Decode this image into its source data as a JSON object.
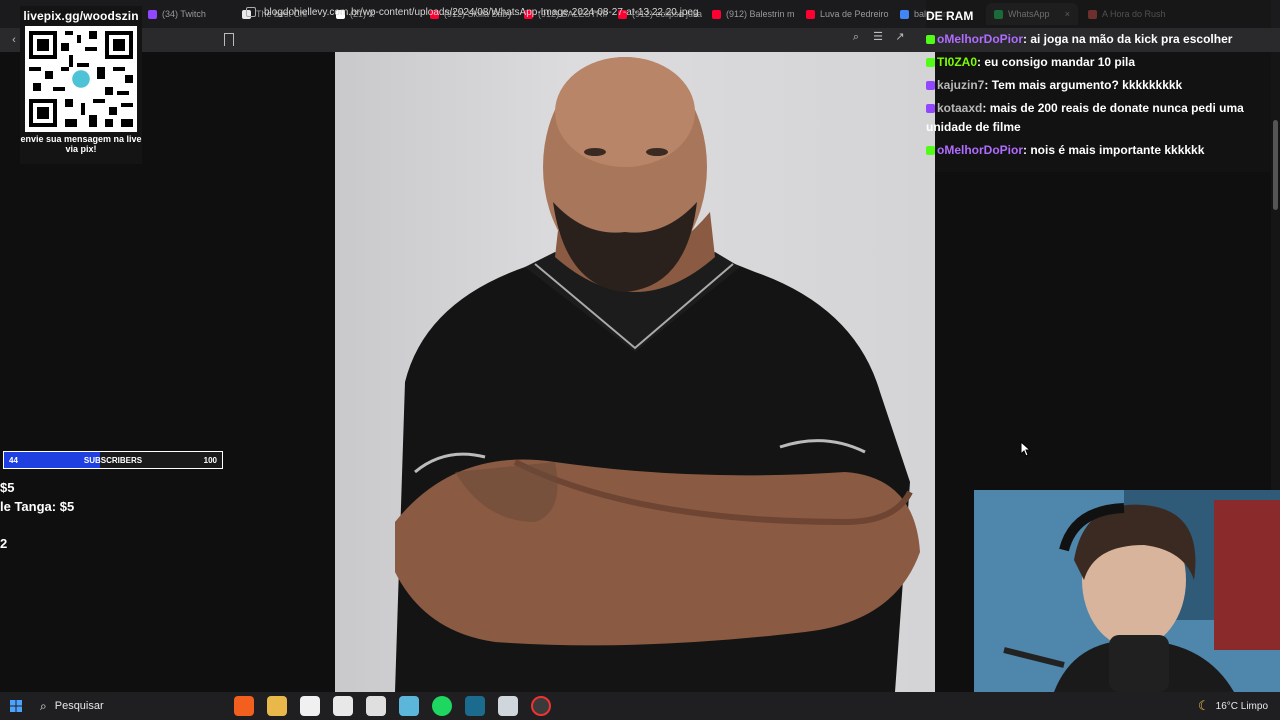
{
  "browser": {
    "tabs": [
      {
        "label": "(34) Twitch",
        "color": "#9146ff"
      },
      {
        "label": "The best Chi",
        "color": "#e8e8e8"
      },
      {
        "label": "(21) X",
        "color": "#ffffff"
      },
      {
        "label": "(912) Skilla Baby",
        "color": "#ff0033"
      },
      {
        "label": "(912) BALESTRIN",
        "color": "#ff0033"
      },
      {
        "label": "(912) eclipse julia",
        "color": "#ff0033"
      },
      {
        "label": "(912) Balestrin m",
        "color": "#ff0033"
      },
      {
        "label": "Luva de Pedreiro",
        "color": "#ff0033"
      },
      {
        "label": "balestrin",
        "color": "#4285f4"
      },
      {
        "label": "WhatsApp",
        "color": "#25d366",
        "active": true
      },
      {
        "label": "A Hora do Rush",
        "color": "#d9534f"
      }
    ],
    "url": "blogdohiellevy.com.br/wp-content/uploads/2024/08/WhatsApp-Image-2024-08-27-at-13.22.20.jpeg"
  },
  "overlay": {
    "qr_title": "livepix.gg/woodszin",
    "qr_caption": "envie sua mensagem na live via pix!",
    "subs_current": "44",
    "subs_label": "SUBSCRIBERS",
    "subs_goal": "100",
    "subs_fraction": 0.44,
    "goal_line1": "$5",
    "goal_line2": "le Tanga: $5",
    "goal_line3": "2"
  },
  "chat": {
    "header": "DE RAM",
    "messages": [
      {
        "user": "oMelhorDoPior",
        "user_color": "#b06cff",
        "text": ": ai joga na mão da kick pra escolher",
        "badge_color": "#53fc18"
      },
      {
        "user": "TI0ZA0",
        "user_color": "#7cfc00",
        "text": ": eu consigo mandar 10 pila",
        "badge_color": "#53fc18"
      },
      {
        "user": "kajuzin7",
        "user_color": "#b8b8b8",
        "text": ": Tem mais argumento? kkkkkkkkk",
        "badge_color": "#9146ff"
      },
      {
        "user": "kotaaxd",
        "user_color": "#b8b8b8",
        "text": ": mais de 200 reais de donate nunca pedi uma unidade de filme",
        "badge_color": "#9146ff"
      },
      {
        "user": "oMelhorDoPior",
        "user_color": "#b06cff",
        "text": ": nois é mais importante kkkkkk",
        "badge_color": "#53fc18"
      }
    ]
  },
  "taskbar": {
    "search_label": "Pesquisar",
    "weather": "16°C  Limpo"
  }
}
